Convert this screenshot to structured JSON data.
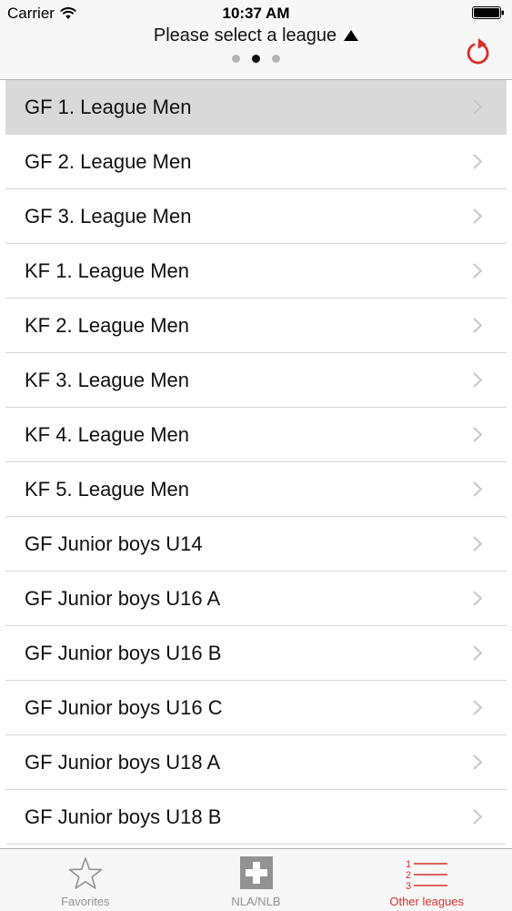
{
  "status_bar": {
    "carrier": "Carrier",
    "time": "10:37 AM"
  },
  "header": {
    "title": "Please select a league",
    "page_count": 3,
    "active_page": 2
  },
  "leagues": [
    {
      "label": "GF 1. League Men",
      "selected": true
    },
    {
      "label": "GF 2. League Men",
      "selected": false
    },
    {
      "label": "GF 3. League Men",
      "selected": false
    },
    {
      "label": "KF 1. League Men",
      "selected": false
    },
    {
      "label": "KF 2. League Men",
      "selected": false
    },
    {
      "label": "KF 3. League Men",
      "selected": false
    },
    {
      "label": "KF 4. League Men",
      "selected": false
    },
    {
      "label": "KF 5. League Men",
      "selected": false
    },
    {
      "label": "GF Junior boys U14",
      "selected": false
    },
    {
      "label": "GF Junior boys U16 A",
      "selected": false
    },
    {
      "label": "GF Junior boys U16 B",
      "selected": false
    },
    {
      "label": "GF Junior boys U16 C",
      "selected": false
    },
    {
      "label": "GF Junior boys U18 A",
      "selected": false
    },
    {
      "label": "GF Junior boys U18 B",
      "selected": false
    }
  ],
  "tab_bar": {
    "tabs": [
      {
        "label": "Favorites",
        "icon": "star-icon",
        "active": false
      },
      {
        "label": "NLA/NLB",
        "icon": "swiss-cross-icon",
        "active": false
      },
      {
        "label": "Other leagues",
        "icon": "numbered-list-icon",
        "active": true
      }
    ],
    "list_numbers": [
      "1",
      "2",
      "3"
    ]
  },
  "colors": {
    "accent": "#d8312a",
    "inactive": "#929292",
    "selected_row": "#d9d9d9"
  }
}
